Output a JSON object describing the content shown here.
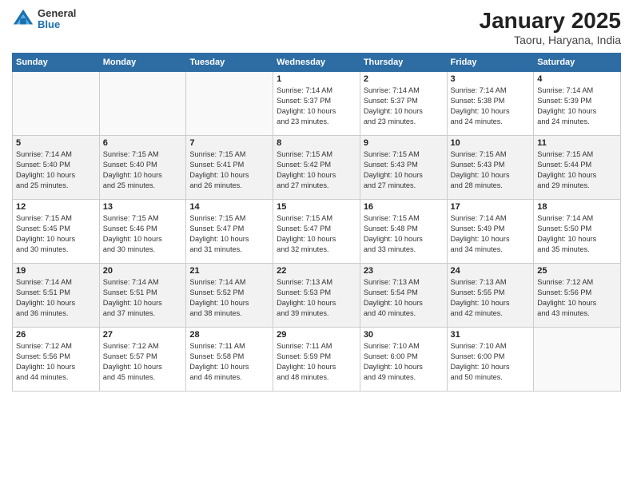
{
  "header": {
    "logo": {
      "line1": "General",
      "line2": "Blue"
    },
    "title": "January 2025",
    "subtitle": "Taoru, Haryana, India"
  },
  "days_of_week": [
    "Sunday",
    "Monday",
    "Tuesday",
    "Wednesday",
    "Thursday",
    "Friday",
    "Saturday"
  ],
  "weeks": [
    [
      {
        "day": "",
        "info": ""
      },
      {
        "day": "",
        "info": ""
      },
      {
        "day": "",
        "info": ""
      },
      {
        "day": "1",
        "info": "Sunrise: 7:14 AM\nSunset: 5:37 PM\nDaylight: 10 hours\nand 23 minutes."
      },
      {
        "day": "2",
        "info": "Sunrise: 7:14 AM\nSunset: 5:37 PM\nDaylight: 10 hours\nand 23 minutes."
      },
      {
        "day": "3",
        "info": "Sunrise: 7:14 AM\nSunset: 5:38 PM\nDaylight: 10 hours\nand 24 minutes."
      },
      {
        "day": "4",
        "info": "Sunrise: 7:14 AM\nSunset: 5:39 PM\nDaylight: 10 hours\nand 24 minutes."
      }
    ],
    [
      {
        "day": "5",
        "info": "Sunrise: 7:14 AM\nSunset: 5:40 PM\nDaylight: 10 hours\nand 25 minutes."
      },
      {
        "day": "6",
        "info": "Sunrise: 7:15 AM\nSunset: 5:40 PM\nDaylight: 10 hours\nand 25 minutes."
      },
      {
        "day": "7",
        "info": "Sunrise: 7:15 AM\nSunset: 5:41 PM\nDaylight: 10 hours\nand 26 minutes."
      },
      {
        "day": "8",
        "info": "Sunrise: 7:15 AM\nSunset: 5:42 PM\nDaylight: 10 hours\nand 27 minutes."
      },
      {
        "day": "9",
        "info": "Sunrise: 7:15 AM\nSunset: 5:43 PM\nDaylight: 10 hours\nand 27 minutes."
      },
      {
        "day": "10",
        "info": "Sunrise: 7:15 AM\nSunset: 5:43 PM\nDaylight: 10 hours\nand 28 minutes."
      },
      {
        "day": "11",
        "info": "Sunrise: 7:15 AM\nSunset: 5:44 PM\nDaylight: 10 hours\nand 29 minutes."
      }
    ],
    [
      {
        "day": "12",
        "info": "Sunrise: 7:15 AM\nSunset: 5:45 PM\nDaylight: 10 hours\nand 30 minutes."
      },
      {
        "day": "13",
        "info": "Sunrise: 7:15 AM\nSunset: 5:46 PM\nDaylight: 10 hours\nand 30 minutes."
      },
      {
        "day": "14",
        "info": "Sunrise: 7:15 AM\nSunset: 5:47 PM\nDaylight: 10 hours\nand 31 minutes."
      },
      {
        "day": "15",
        "info": "Sunrise: 7:15 AM\nSunset: 5:47 PM\nDaylight: 10 hours\nand 32 minutes."
      },
      {
        "day": "16",
        "info": "Sunrise: 7:15 AM\nSunset: 5:48 PM\nDaylight: 10 hours\nand 33 minutes."
      },
      {
        "day": "17",
        "info": "Sunrise: 7:14 AM\nSunset: 5:49 PM\nDaylight: 10 hours\nand 34 minutes."
      },
      {
        "day": "18",
        "info": "Sunrise: 7:14 AM\nSunset: 5:50 PM\nDaylight: 10 hours\nand 35 minutes."
      }
    ],
    [
      {
        "day": "19",
        "info": "Sunrise: 7:14 AM\nSunset: 5:51 PM\nDaylight: 10 hours\nand 36 minutes."
      },
      {
        "day": "20",
        "info": "Sunrise: 7:14 AM\nSunset: 5:51 PM\nDaylight: 10 hours\nand 37 minutes."
      },
      {
        "day": "21",
        "info": "Sunrise: 7:14 AM\nSunset: 5:52 PM\nDaylight: 10 hours\nand 38 minutes."
      },
      {
        "day": "22",
        "info": "Sunrise: 7:13 AM\nSunset: 5:53 PM\nDaylight: 10 hours\nand 39 minutes."
      },
      {
        "day": "23",
        "info": "Sunrise: 7:13 AM\nSunset: 5:54 PM\nDaylight: 10 hours\nand 40 minutes."
      },
      {
        "day": "24",
        "info": "Sunrise: 7:13 AM\nSunset: 5:55 PM\nDaylight: 10 hours\nand 42 minutes."
      },
      {
        "day": "25",
        "info": "Sunrise: 7:12 AM\nSunset: 5:56 PM\nDaylight: 10 hours\nand 43 minutes."
      }
    ],
    [
      {
        "day": "26",
        "info": "Sunrise: 7:12 AM\nSunset: 5:56 PM\nDaylight: 10 hours\nand 44 minutes."
      },
      {
        "day": "27",
        "info": "Sunrise: 7:12 AM\nSunset: 5:57 PM\nDaylight: 10 hours\nand 45 minutes."
      },
      {
        "day": "28",
        "info": "Sunrise: 7:11 AM\nSunset: 5:58 PM\nDaylight: 10 hours\nand 46 minutes."
      },
      {
        "day": "29",
        "info": "Sunrise: 7:11 AM\nSunset: 5:59 PM\nDaylight: 10 hours\nand 48 minutes."
      },
      {
        "day": "30",
        "info": "Sunrise: 7:10 AM\nSunset: 6:00 PM\nDaylight: 10 hours\nand 49 minutes."
      },
      {
        "day": "31",
        "info": "Sunrise: 7:10 AM\nSunset: 6:00 PM\nDaylight: 10 hours\nand 50 minutes."
      },
      {
        "day": "",
        "info": ""
      }
    ]
  ]
}
